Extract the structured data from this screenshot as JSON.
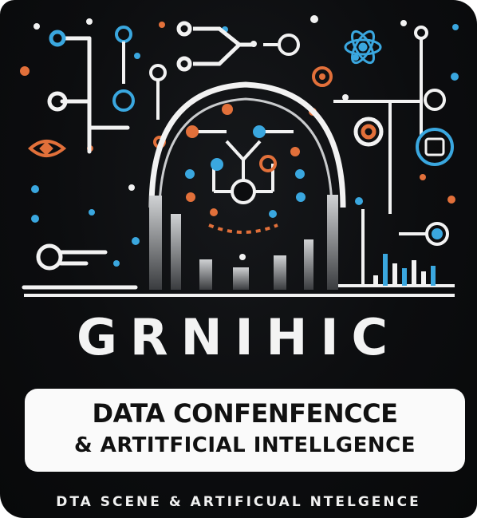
{
  "poster": {
    "headline": "GRNIHIC",
    "banner_line1": "DATA CONFENFENCCE",
    "banner_line2": "& ARTITFICIAL   INTELLGENCE",
    "tagline": "DTA SCENE & ARTIFICUAL NTELGENCE"
  },
  "icons": [
    "brain-circuit-icon",
    "neural-network-icon",
    "atom-icon",
    "eye-icon",
    "bar-chart-icon",
    "target-icon",
    "circuit-node-icon"
  ],
  "colors": {
    "background": "#0c0d0f",
    "orange": "#e2703a",
    "blue": "#3aa7df",
    "white": "#f2f2f2",
    "gray": "#8a8d91"
  }
}
